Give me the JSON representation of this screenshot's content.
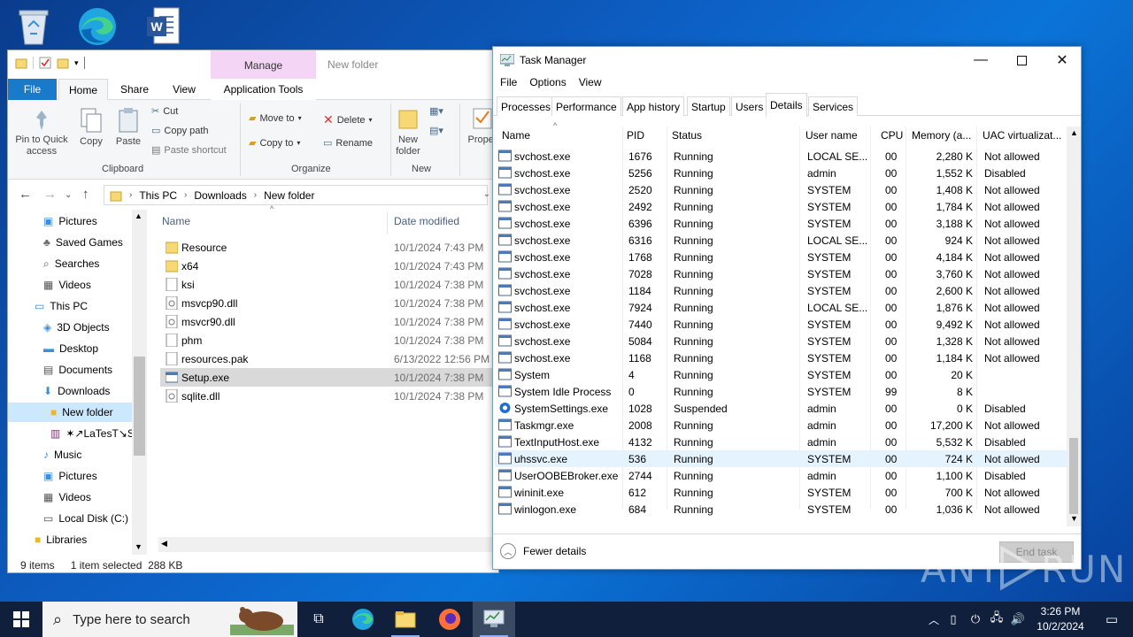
{
  "explorer": {
    "title": "New folder",
    "manage_tab": "Manage",
    "tabs": {
      "file": "File",
      "home": "Home",
      "share": "Share",
      "view": "View",
      "app_tools": "Application Tools"
    },
    "ribbon": {
      "pin_to_quick_access": "Pin to Quick access",
      "copy": "Copy",
      "paste": "Paste",
      "cut": "Cut",
      "copy_path": "Copy path",
      "paste_shortcut": "Paste shortcut",
      "clipboard_group": "Clipboard",
      "move_to": "Move to",
      "copy_to": "Copy to",
      "delete": "Delete",
      "rename": "Rename",
      "organize_group": "Organize",
      "new_folder": "New folder",
      "new_group": "New",
      "properties": "Proper"
    },
    "breadcrumb": [
      "This PC",
      "Downloads",
      "New folder"
    ],
    "nav_items": [
      {
        "label": "Pictures",
        "icon": "pictures-icon"
      },
      {
        "label": "Saved Games",
        "icon": "saved-games-icon"
      },
      {
        "label": "Searches",
        "icon": "search-icon"
      },
      {
        "label": "Videos",
        "icon": "videos-icon"
      },
      {
        "label": "This PC",
        "icon": "computer-icon"
      },
      {
        "label": "3D Objects",
        "icon": "3d-objects-icon"
      },
      {
        "label": "Desktop",
        "icon": "desktop-icon"
      },
      {
        "label": "Documents",
        "icon": "documents-icon"
      },
      {
        "label": "Downloads",
        "icon": "downloads-icon"
      },
      {
        "label": "New folder",
        "icon": "folder-icon"
      },
      {
        "label": "✶↗LaTesT↘S",
        "icon": "archive-icon"
      },
      {
        "label": "Music",
        "icon": "music-icon"
      },
      {
        "label": "Pictures",
        "icon": "pictures-icon"
      },
      {
        "label": "Videos",
        "icon": "videos-icon"
      },
      {
        "label": "Local Disk (C:)",
        "icon": "disk-icon"
      },
      {
        "label": "Libraries",
        "icon": "libraries-icon"
      }
    ],
    "columns": {
      "name": "Name",
      "date_modified": "Date modified"
    },
    "files": [
      {
        "name": "Resource",
        "date": "10/1/2024 7:43 PM",
        "type": "folder"
      },
      {
        "name": "x64",
        "date": "10/1/2024 7:43 PM",
        "type": "folder"
      },
      {
        "name": "ksi",
        "date": "10/1/2024 7:38 PM",
        "type": "file"
      },
      {
        "name": "msvcp90.dll",
        "date": "10/1/2024 7:38 PM",
        "type": "dll"
      },
      {
        "name": "msvcr90.dll",
        "date": "10/1/2024 7:38 PM",
        "type": "dll"
      },
      {
        "name": "phm",
        "date": "10/1/2024 7:38 PM",
        "type": "file"
      },
      {
        "name": "resources.pak",
        "date": "6/13/2022 12:56 PM",
        "type": "file"
      },
      {
        "name": "Setup.exe",
        "date": "10/1/2024 7:38 PM",
        "type": "exe"
      },
      {
        "name": "sqlite.dll",
        "date": "10/1/2024 7:38 PM",
        "type": "dll"
      }
    ],
    "status": {
      "count": "9 items",
      "selection": "1 item selected  288 KB"
    }
  },
  "taskmgr": {
    "title": "Task Manager",
    "menu": [
      "File",
      "Options",
      "View"
    ],
    "tabs": [
      "Processes",
      "Performance",
      "App history",
      "Startup",
      "Users",
      "Details",
      "Services"
    ],
    "active_tab": "Details",
    "columns": [
      "Name",
      "PID",
      "Status",
      "User name",
      "CPU",
      "Memory (a...",
      "UAC virtualizat..."
    ],
    "rows": [
      {
        "name": "svchost.exe",
        "pid": "1676",
        "status": "Running",
        "user": "LOCAL SE...",
        "cpu": "00",
        "mem": "2,280 K",
        "uac": "Not allowed"
      },
      {
        "name": "svchost.exe",
        "pid": "5256",
        "status": "Running",
        "user": "admin",
        "cpu": "00",
        "mem": "1,552 K",
        "uac": "Disabled"
      },
      {
        "name": "svchost.exe",
        "pid": "2520",
        "status": "Running",
        "user": "SYSTEM",
        "cpu": "00",
        "mem": "1,408 K",
        "uac": "Not allowed"
      },
      {
        "name": "svchost.exe",
        "pid": "2492",
        "status": "Running",
        "user": "SYSTEM",
        "cpu": "00",
        "mem": "1,784 K",
        "uac": "Not allowed"
      },
      {
        "name": "svchost.exe",
        "pid": "6396",
        "status": "Running",
        "user": "SYSTEM",
        "cpu": "00",
        "mem": "3,188 K",
        "uac": "Not allowed"
      },
      {
        "name": "svchost.exe",
        "pid": "6316",
        "status": "Running",
        "user": "LOCAL SE...",
        "cpu": "00",
        "mem": "924 K",
        "uac": "Not allowed"
      },
      {
        "name": "svchost.exe",
        "pid": "1768",
        "status": "Running",
        "user": "SYSTEM",
        "cpu": "00",
        "mem": "4,184 K",
        "uac": "Not allowed"
      },
      {
        "name": "svchost.exe",
        "pid": "7028",
        "status": "Running",
        "user": "SYSTEM",
        "cpu": "00",
        "mem": "3,760 K",
        "uac": "Not allowed"
      },
      {
        "name": "svchost.exe",
        "pid": "1184",
        "status": "Running",
        "user": "SYSTEM",
        "cpu": "00",
        "mem": "2,600 K",
        "uac": "Not allowed"
      },
      {
        "name": "svchost.exe",
        "pid": "7924",
        "status": "Running",
        "user": "LOCAL SE...",
        "cpu": "00",
        "mem": "1,876 K",
        "uac": "Not allowed"
      },
      {
        "name": "svchost.exe",
        "pid": "7440",
        "status": "Running",
        "user": "SYSTEM",
        "cpu": "00",
        "mem": "9,492 K",
        "uac": "Not allowed"
      },
      {
        "name": "svchost.exe",
        "pid": "5084",
        "status": "Running",
        "user": "SYSTEM",
        "cpu": "00",
        "mem": "1,328 K",
        "uac": "Not allowed"
      },
      {
        "name": "svchost.exe",
        "pid": "1168",
        "status": "Running",
        "user": "SYSTEM",
        "cpu": "00",
        "mem": "1,184 K",
        "uac": "Not allowed"
      },
      {
        "name": "System",
        "pid": "4",
        "status": "Running",
        "user": "SYSTEM",
        "cpu": "00",
        "mem": "20 K",
        "uac": ""
      },
      {
        "name": "System Idle Process",
        "pid": "0",
        "status": "Running",
        "user": "SYSTEM",
        "cpu": "99",
        "mem": "8 K",
        "uac": ""
      },
      {
        "name": "SystemSettings.exe",
        "pid": "1028",
        "status": "Suspended",
        "user": "admin",
        "cpu": "00",
        "mem": "0 K",
        "uac": "Disabled"
      },
      {
        "name": "Taskmgr.exe",
        "pid": "2008",
        "status": "Running",
        "user": "admin",
        "cpu": "00",
        "mem": "17,200 K",
        "uac": "Not allowed"
      },
      {
        "name": "TextInputHost.exe",
        "pid": "4132",
        "status": "Running",
        "user": "admin",
        "cpu": "00",
        "mem": "5,532 K",
        "uac": "Disabled"
      },
      {
        "name": "uhssvc.exe",
        "pid": "536",
        "status": "Running",
        "user": "SYSTEM",
        "cpu": "00",
        "mem": "724 K",
        "uac": "Not allowed"
      },
      {
        "name": "UserOOBEBroker.exe",
        "pid": "2744",
        "status": "Running",
        "user": "admin",
        "cpu": "00",
        "mem": "1,100 K",
        "uac": "Disabled"
      },
      {
        "name": "wininit.exe",
        "pid": "612",
        "status": "Running",
        "user": "SYSTEM",
        "cpu": "00",
        "mem": "700 K",
        "uac": "Not allowed"
      },
      {
        "name": "winlogon.exe",
        "pid": "684",
        "status": "Running",
        "user": "SYSTEM",
        "cpu": "00",
        "mem": "1,036 K",
        "uac": "Not allowed"
      }
    ],
    "fewer_details": "Fewer details",
    "end_task": "End task"
  },
  "taskbar": {
    "search_placeholder": "Type here to search",
    "time": "3:26 PM",
    "date": "10/2/2024"
  },
  "watermark": "ANY.RUN",
  "colors": {
    "accent": "#1979ca",
    "selection": "#cce8ff",
    "desktop": "#0d5fc4",
    "taskbar": "#10203c"
  }
}
